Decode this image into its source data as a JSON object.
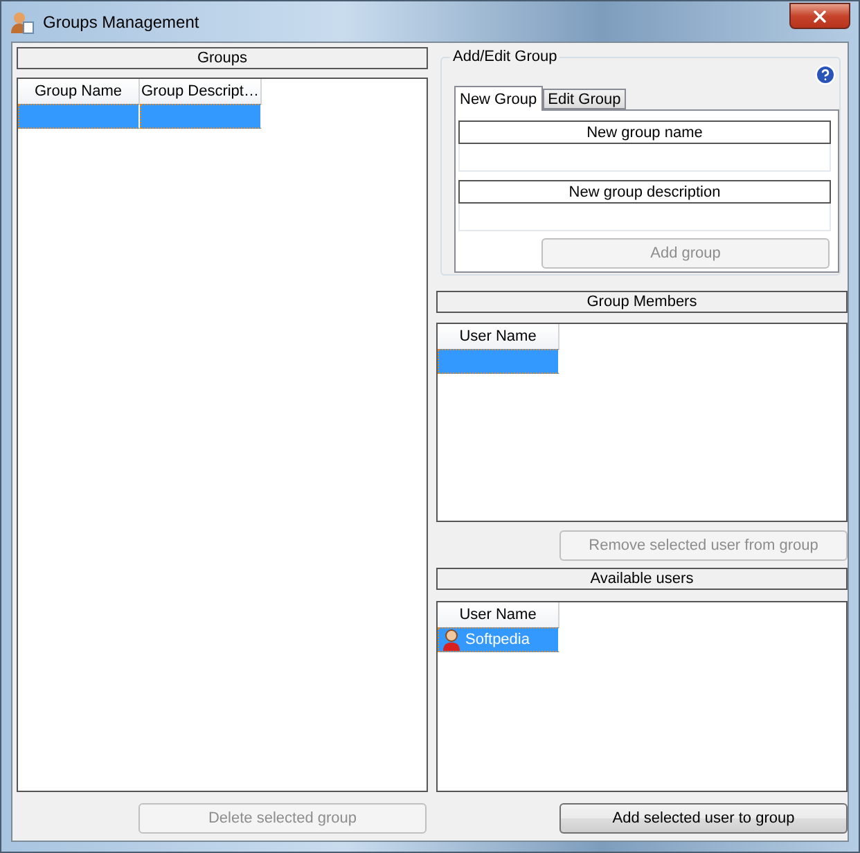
{
  "window": {
    "title": "Groups Management"
  },
  "groups": {
    "header": "Groups",
    "columns": [
      "Group Name",
      "Group Descript…"
    ],
    "rows": [
      {
        "selected": true
      }
    ],
    "delete_button": {
      "label": "Delete selected group",
      "disabled": true
    }
  },
  "add_edit": {
    "title": "Add/Edit Group",
    "tabs": [
      {
        "label": "New Group",
        "selected": true
      },
      {
        "label": "Edit Group",
        "selected": false
      }
    ],
    "name_label": "New group name",
    "description_label": "New group description",
    "add_button": {
      "label": "Add group",
      "disabled": true
    }
  },
  "members": {
    "header": "Group Members",
    "columns": [
      "User Name"
    ],
    "rows": [
      {
        "selected": true
      }
    ],
    "remove_button": {
      "label": "Remove selected user from group",
      "disabled": true
    }
  },
  "available": {
    "header": "Available users",
    "columns": [
      "User Name"
    ],
    "rows": [
      {
        "name": "Softpedia",
        "selected": true
      }
    ],
    "add_button": {
      "label": "Add selected user to group",
      "disabled": false
    }
  }
}
